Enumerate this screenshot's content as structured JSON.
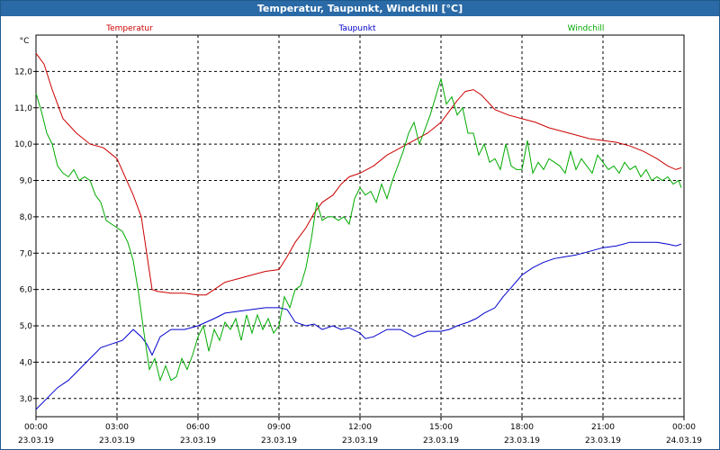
{
  "window": {
    "title": "Temperatur, Taupunkt, Windchill [°C]"
  },
  "chart_data": {
    "type": "line",
    "title": "Temperatur, Taupunkt, Windchill [°C]",
    "ylabel": "°C",
    "ylim": [
      2.5,
      13.0
    ],
    "yticks": [
      3.0,
      4.0,
      5.0,
      6.0,
      7.0,
      8.0,
      9.0,
      10.0,
      11.0,
      12.0
    ],
    "ytick_labels": [
      "3,0",
      "4,0",
      "5,0",
      "6,0",
      "7,0",
      "8,0",
      "9,0",
      "10,0",
      "11,0",
      "12,0"
    ],
    "xlim": [
      0,
      24
    ],
    "xticks": [
      0,
      3,
      6,
      9,
      12,
      15,
      18,
      21,
      24
    ],
    "xtick_time_labels": [
      "00:00",
      "03:00",
      "06:00",
      "09:00",
      "12:00",
      "15:00",
      "18:00",
      "21:00",
      "00:00"
    ],
    "xtick_date_labels": [
      "23.03.19",
      "23.03.19",
      "23.03.19",
      "23.03.19",
      "23.03.19",
      "23.03.19",
      "23.03.19",
      "23.03.19",
      "24.03.19"
    ],
    "grid": true,
    "series": [
      {
        "name": "Temperatur",
        "color": "#cc0000",
        "x": [
          0,
          0.3,
          0.6,
          1.0,
          1.5,
          2.0,
          2.5,
          3.0,
          3.3,
          3.6,
          3.9,
          4.1,
          4.3,
          4.5,
          5.0,
          5.5,
          6.0,
          6.3,
          6.6,
          7.0,
          7.5,
          8.0,
          8.5,
          9.0,
          9.3,
          9.6,
          10.0,
          10.3,
          10.6,
          11.0,
          11.3,
          11.6,
          12.0,
          12.5,
          13.0,
          13.5,
          14.0,
          14.5,
          15.0,
          15.3,
          15.6,
          15.9,
          16.2,
          16.5,
          17.0,
          17.5,
          18.0,
          18.5,
          19.0,
          19.5,
          20.0,
          20.5,
          21.0,
          21.5,
          22.0,
          22.5,
          23.0,
          23.4,
          23.7,
          23.9
        ],
        "y": [
          12.5,
          12.2,
          11.5,
          10.7,
          10.3,
          10.0,
          9.9,
          9.6,
          9.1,
          8.6,
          8.0,
          7.0,
          6.0,
          5.95,
          5.9,
          5.9,
          5.85,
          5.85,
          6.0,
          6.2,
          6.3,
          6.4,
          6.5,
          6.55,
          6.9,
          7.3,
          7.7,
          8.1,
          8.4,
          8.6,
          8.9,
          9.1,
          9.2,
          9.4,
          9.7,
          9.9,
          10.1,
          10.3,
          10.6,
          10.9,
          11.2,
          11.45,
          11.5,
          11.35,
          10.95,
          10.8,
          10.7,
          10.6,
          10.45,
          10.35,
          10.25,
          10.15,
          10.1,
          10.05,
          9.95,
          9.8,
          9.6,
          9.4,
          9.3,
          9.35
        ]
      },
      {
        "name": "Taupunkt",
        "color": "#0000cc",
        "x": [
          0,
          0.4,
          0.8,
          1.2,
          1.6,
          2.0,
          2.4,
          2.8,
          3.2,
          3.6,
          3.9,
          4.1,
          4.3,
          4.6,
          5.0,
          5.5,
          6.0,
          6.3,
          6.6,
          7.0,
          7.5,
          8.0,
          8.5,
          9.0,
          9.3,
          9.6,
          10.0,
          10.3,
          10.6,
          11.0,
          11.3,
          11.6,
          12.0,
          12.2,
          12.5,
          13.0,
          13.5,
          14.0,
          14.5,
          15.0,
          15.3,
          15.6,
          16.0,
          16.3,
          16.6,
          17.0,
          17.3,
          17.6,
          18.0,
          18.4,
          18.8,
          19.2,
          19.6,
          20.0,
          20.5,
          21.0,
          21.5,
          22.0,
          22.5,
          23.0,
          23.4,
          23.7,
          23.9
        ],
        "y": [
          2.7,
          3.0,
          3.3,
          3.5,
          3.8,
          4.1,
          4.4,
          4.5,
          4.6,
          4.9,
          4.7,
          4.5,
          4.2,
          4.7,
          4.9,
          4.9,
          5.0,
          5.1,
          5.2,
          5.35,
          5.4,
          5.45,
          5.5,
          5.5,
          5.45,
          5.1,
          5.0,
          5.05,
          4.9,
          5.0,
          4.9,
          4.95,
          4.8,
          4.65,
          4.7,
          4.9,
          4.9,
          4.7,
          4.85,
          4.85,
          4.9,
          5.0,
          5.1,
          5.2,
          5.35,
          5.5,
          5.8,
          6.05,
          6.4,
          6.6,
          6.75,
          6.85,
          6.9,
          6.95,
          7.05,
          7.15,
          7.2,
          7.3,
          7.3,
          7.3,
          7.25,
          7.2,
          7.25
        ]
      },
      {
        "name": "Windchill",
        "color": "#00aa00",
        "x": [
          0,
          0.2,
          0.4,
          0.6,
          0.8,
          1.0,
          1.2,
          1.4,
          1.6,
          1.8,
          2.0,
          2.2,
          2.4,
          2.6,
          2.8,
          3.0,
          3.2,
          3.4,
          3.6,
          3.8,
          4.0,
          4.2,
          4.4,
          4.6,
          4.8,
          5.0,
          5.2,
          5.4,
          5.6,
          5.8,
          6.0,
          6.2,
          6.4,
          6.6,
          6.8,
          7.0,
          7.2,
          7.4,
          7.6,
          7.8,
          8.0,
          8.2,
          8.4,
          8.6,
          8.8,
          9.0,
          9.2,
          9.4,
          9.6,
          9.8,
          10.0,
          10.2,
          10.4,
          10.6,
          10.8,
          11.0,
          11.2,
          11.4,
          11.6,
          11.8,
          12.0,
          12.2,
          12.4,
          12.6,
          12.8,
          13.0,
          13.2,
          13.4,
          13.6,
          13.8,
          14.0,
          14.2,
          14.4,
          14.6,
          14.8,
          15.0,
          15.2,
          15.4,
          15.6,
          15.8,
          16.0,
          16.2,
          16.4,
          16.6,
          16.8,
          17.0,
          17.2,
          17.4,
          17.6,
          17.8,
          18.0,
          18.2,
          18.4,
          18.6,
          18.8,
          19.0,
          19.2,
          19.4,
          19.6,
          19.8,
          20.0,
          20.2,
          20.4,
          20.6,
          20.8,
          21.0,
          21.2,
          21.4,
          21.6,
          21.8,
          22.0,
          22.2,
          22.4,
          22.6,
          22.8,
          23.0,
          23.2,
          23.4,
          23.6,
          23.8,
          23.9
        ],
        "y": [
          11.4,
          10.9,
          10.3,
          10.0,
          9.4,
          9.2,
          9.1,
          9.3,
          9.0,
          9.1,
          9.0,
          8.6,
          8.4,
          7.9,
          7.8,
          7.7,
          7.6,
          7.3,
          6.8,
          5.9,
          4.8,
          3.8,
          4.1,
          3.5,
          3.9,
          3.5,
          3.6,
          4.1,
          3.8,
          4.2,
          4.7,
          5.0,
          4.3,
          4.9,
          4.6,
          5.1,
          4.9,
          5.2,
          4.6,
          5.3,
          4.8,
          5.3,
          4.9,
          5.2,
          4.8,
          5.0,
          5.8,
          5.5,
          6.0,
          6.1,
          6.6,
          7.4,
          8.4,
          7.9,
          8.0,
          8.0,
          7.9,
          8.0,
          7.8,
          8.5,
          8.8,
          8.6,
          8.7,
          8.4,
          8.9,
          8.5,
          9.0,
          9.4,
          9.8,
          10.3,
          10.6,
          10.0,
          10.4,
          10.8,
          11.3,
          11.8,
          11.1,
          11.3,
          10.8,
          11.0,
          10.3,
          10.3,
          9.7,
          10.0,
          9.5,
          9.6,
          9.3,
          10.0,
          9.4,
          9.3,
          9.3,
          10.1,
          9.2,
          9.5,
          9.3,
          9.6,
          9.5,
          9.4,
          9.2,
          9.8,
          9.3,
          9.6,
          9.4,
          9.2,
          9.7,
          9.5,
          9.3,
          9.4,
          9.2,
          9.5,
          9.3,
          9.4,
          9.1,
          9.3,
          9.0,
          9.1,
          9.0,
          9.1,
          8.9,
          9.0,
          8.8
        ]
      }
    ]
  }
}
